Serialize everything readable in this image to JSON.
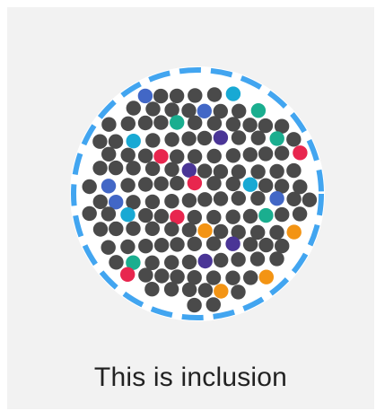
{
  "caption": "This is inclusion",
  "colors": {
    "card_background": "#f2f2f2",
    "circle_background": "#ffffff",
    "dashed_ring": "#42a5f0",
    "dot_majority": "#4a4a4a",
    "dot_accents": [
      "#4267c6",
      "#e8264e",
      "#1aae8f",
      "#18a9d4",
      "#f39414",
      "#4a3596"
    ]
  },
  "illustration": {
    "description_name": "crowd-of-dots-inclusion-illustration",
    "accent_dot_count": 27,
    "accent_colors_in_order": [
      "#4267c6",
      "#e8264e",
      "#1aae8f",
      "#4a3596",
      "#18a9d4",
      "#1aae8f",
      "#f39414",
      "#e8264e",
      "#f39414",
      "#4267c6",
      "#18a9d4",
      "#4a3596",
      "#4267c6",
      "#18a9d4",
      "#1aae8f",
      "#e8264e",
      "#e8264e",
      "#4267c6",
      "#1aae8f",
      "#f39414",
      "#4a3596",
      "#f39414",
      "#18a9d4",
      "#4a3596",
      "#1aae8f",
      "#e8264e",
      "#4267c6"
    ]
  }
}
